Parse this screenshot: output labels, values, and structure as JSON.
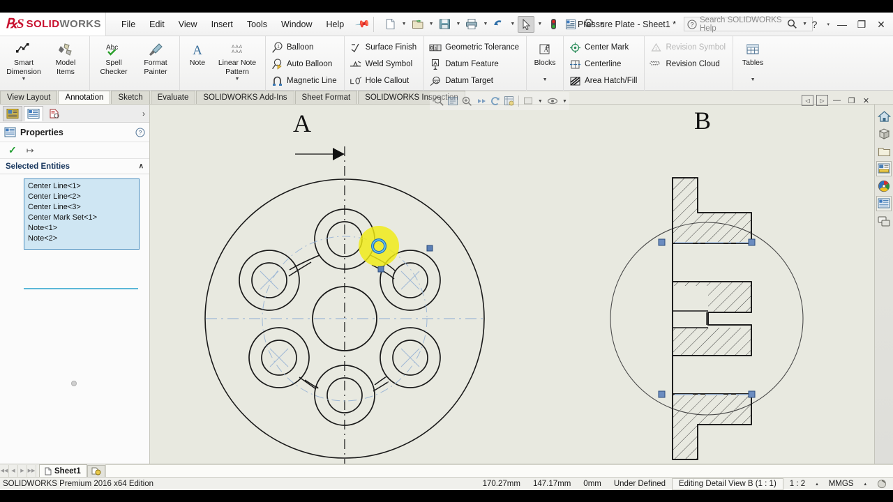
{
  "app": {
    "brand_ds": "2S",
    "brand_solid": "SOLID",
    "brand_works": "WORKS",
    "document_title": "Pressure Plate - Sheet1 *",
    "edition": "SOLIDWORKS Premium 2016 x64 Edition",
    "accent_color": "#c8102e",
    "canvas_color": "#e8e9e0"
  },
  "menubar": {
    "items": [
      {
        "label": "File",
        "name": "menu-file"
      },
      {
        "label": "Edit",
        "name": "menu-edit"
      },
      {
        "label": "View",
        "name": "menu-view"
      },
      {
        "label": "Insert",
        "name": "menu-insert"
      },
      {
        "label": "Tools",
        "name": "menu-tools"
      },
      {
        "label": "Window",
        "name": "menu-window"
      },
      {
        "label": "Help",
        "name": "menu-help"
      }
    ],
    "pin_icon": "pin-icon"
  },
  "quick_access": {
    "buttons": [
      {
        "name": "new-document-icon",
        "dropdown": true
      },
      {
        "name": "open-document-icon",
        "dropdown": true
      },
      {
        "name": "save-icon",
        "dropdown": true
      },
      {
        "name": "print-icon",
        "dropdown": true
      },
      {
        "name": "undo-icon",
        "dropdown": true
      },
      {
        "name": "select-cursor-icon",
        "dropdown": true,
        "active": true
      },
      {
        "name": "rebuild-traffic-light-icon",
        "dropdown": false
      },
      {
        "name": "drawing-properties-icon",
        "dropdown": false
      },
      {
        "name": "options-gear-icon",
        "dropdown": true
      }
    ]
  },
  "search": {
    "placeholder": "Search SOLIDWORKS Help",
    "help_icon": "question-circle-icon",
    "magnifier_icon": "search-icon"
  },
  "window_controls": {
    "help": "?",
    "help_caret": "▾",
    "minimize": "—",
    "restore": "❐",
    "close": "✕"
  },
  "ribbon": {
    "groups": [
      {
        "name": "dimensions-group",
        "big_buttons": [
          {
            "label_line1": "Smart",
            "label_line2": "Dimension",
            "icon": "smart-dimension-icon",
            "dropdown": true
          },
          {
            "label_line1": "Model",
            "label_line2": "Items",
            "icon": "model-items-icon",
            "dropdown": false
          }
        ]
      },
      {
        "name": "spelling-group",
        "big_buttons": [
          {
            "label_line1": "Spell",
            "label_line2": "Checker",
            "icon": "spell-checker-icon",
            "dropdown": false
          },
          {
            "label_line1": "Format",
            "label_line2": "Painter",
            "icon": "format-painter-icon",
            "dropdown": false
          }
        ]
      },
      {
        "name": "note-group",
        "big_buttons": [
          {
            "label_line1": "Note",
            "label_line2": "",
            "icon": "note-icon",
            "dropdown": false
          },
          {
            "label_line1": "Linear Note",
            "label_line2": "Pattern",
            "icon": "linear-note-pattern-icon",
            "dropdown": true
          }
        ]
      },
      {
        "name": "balloon-group",
        "small_buttons": [
          {
            "label": "Balloon",
            "icon": "balloon-icon",
            "disabled": false
          },
          {
            "label": "Auto Balloon",
            "icon": "auto-balloon-icon",
            "disabled": false
          },
          {
            "label": "Magnetic Line",
            "icon": "magnetic-line-icon",
            "disabled": false
          }
        ]
      },
      {
        "name": "symbols-group",
        "small_buttons": [
          {
            "label": "Surface Finish",
            "icon": "surface-finish-icon",
            "disabled": false
          },
          {
            "label": "Weld Symbol",
            "icon": "weld-symbol-icon",
            "disabled": false
          },
          {
            "label": "Hole Callout",
            "icon": "hole-callout-icon",
            "disabled": false
          }
        ]
      },
      {
        "name": "tolerance-group",
        "small_buttons": [
          {
            "label": "Geometric Tolerance",
            "icon": "geometric-tolerance-icon",
            "disabled": false
          },
          {
            "label": "Datum Feature",
            "icon": "datum-feature-icon",
            "disabled": false
          },
          {
            "label": "Datum Target",
            "icon": "datum-target-icon",
            "disabled": false
          }
        ]
      },
      {
        "name": "blocks-group",
        "big_buttons": [
          {
            "label_line1": "Blocks",
            "label_line2": "",
            "icon": "blocks-icon",
            "dropdown": true
          }
        ]
      },
      {
        "name": "annotation-group",
        "small_buttons": [
          {
            "label": "Center Mark",
            "icon": "center-mark-icon",
            "disabled": false
          },
          {
            "label": "Centerline",
            "icon": "centerline-icon",
            "disabled": false
          },
          {
            "label": "Area Hatch/Fill",
            "icon": "area-hatch-fill-icon",
            "disabled": false
          }
        ]
      },
      {
        "name": "revision-group",
        "small_buttons": [
          {
            "label": "Revision Symbol",
            "icon": "revision-symbol-icon",
            "disabled": true
          },
          {
            "label": "Revision Cloud",
            "icon": "revision-cloud-icon",
            "disabled": false
          }
        ]
      },
      {
        "name": "tables-group",
        "big_buttons": [
          {
            "label_line1": "Tables",
            "label_line2": "",
            "icon": "tables-icon",
            "dropdown": true
          }
        ]
      }
    ]
  },
  "tabs": {
    "active": "Annotation",
    "items": [
      {
        "label": "View Layout",
        "name": "tab-view-layout"
      },
      {
        "label": "Annotation",
        "name": "tab-annotation"
      },
      {
        "label": "Sketch",
        "name": "tab-sketch"
      },
      {
        "label": "Evaluate",
        "name": "tab-evaluate"
      },
      {
        "label": "SOLIDWORKS Add-Ins",
        "name": "tab-solidworks-add-ins"
      },
      {
        "label": "Sheet Format",
        "name": "tab-sheet-format"
      },
      {
        "label": "SOLIDWORKS Inspection",
        "name": "tab-solidworks-inspection"
      }
    ]
  },
  "left_panel": {
    "tabs": [
      {
        "name": "feature-manager-tree-tab"
      },
      {
        "name": "property-manager-tab"
      },
      {
        "name": "configuration-manager-tab"
      }
    ],
    "expand_chevron": "›",
    "title": "Properties",
    "help_icon": "question-circle-icon",
    "accept_icon": "check-icon",
    "pin_icon": "pin-icon",
    "section_title": "Selected Entities",
    "section_caret": "∧",
    "selected_entities": [
      "Center Line<1>",
      "Center Line<2>",
      "Center Line<3>",
      "Center Mark Set<1>",
      "Note<1>",
      "Note<2>"
    ]
  },
  "canvas": {
    "view_labels": [
      {
        "text": "A",
        "name": "section-view-label-a"
      },
      {
        "text": "B",
        "name": "detail-view-label-b"
      }
    ],
    "floating_toolbar": [
      {
        "name": "zoom-to-area-icon"
      },
      {
        "name": "zoom-to-fit-icon"
      },
      {
        "name": "zoom-in-out-icon"
      },
      {
        "name": "previous-view-icon"
      },
      {
        "name": "rotate-view-icon"
      },
      {
        "name": "view-orientation-icon"
      },
      {
        "name": "display-style-icon"
      },
      {
        "name": "hide-show-items-icon"
      }
    ],
    "view_window_controls": [
      {
        "name": "restore-left-icon",
        "glyph": "◁"
      },
      {
        "name": "restore-right-icon",
        "glyph": "▷"
      },
      {
        "name": "minimize-view-icon",
        "glyph": "—"
      },
      {
        "name": "maximize-view-icon",
        "glyph": "❐"
      },
      {
        "name": "close-view-icon",
        "glyph": "✕"
      }
    ]
  },
  "right_toolbar": {
    "buttons": [
      {
        "name": "home-icon"
      },
      {
        "name": "solidworks-resources-icon"
      },
      {
        "name": "file-explorer-icon"
      },
      {
        "name": "view-palette-icon"
      },
      {
        "name": "appearances-scenes-icon"
      },
      {
        "name": "custom-properties-icon"
      },
      {
        "name": "design-library-icon"
      }
    ]
  },
  "sheet_bar": {
    "nav": [
      "◀◀",
      "◀",
      "▶",
      "▶▶"
    ],
    "active_sheet": "Sheet1",
    "sheet_icon": "sheet-icon",
    "add_sheet_icon": "add-sheet-icon"
  },
  "status_bar": {
    "edition": "SOLIDWORKS Premium 2016 x64 Edition",
    "coord_x": "170.27mm",
    "coord_y": "147.17mm",
    "coord_z": "0mm",
    "state": "Under Defined",
    "editing": "Editing Detail View B (1 : 1)",
    "scale": "1 : 2",
    "scale_caret": "▴",
    "units": "MMGS",
    "units_caret": "▴",
    "overlay_icon": "spinner-icon"
  }
}
